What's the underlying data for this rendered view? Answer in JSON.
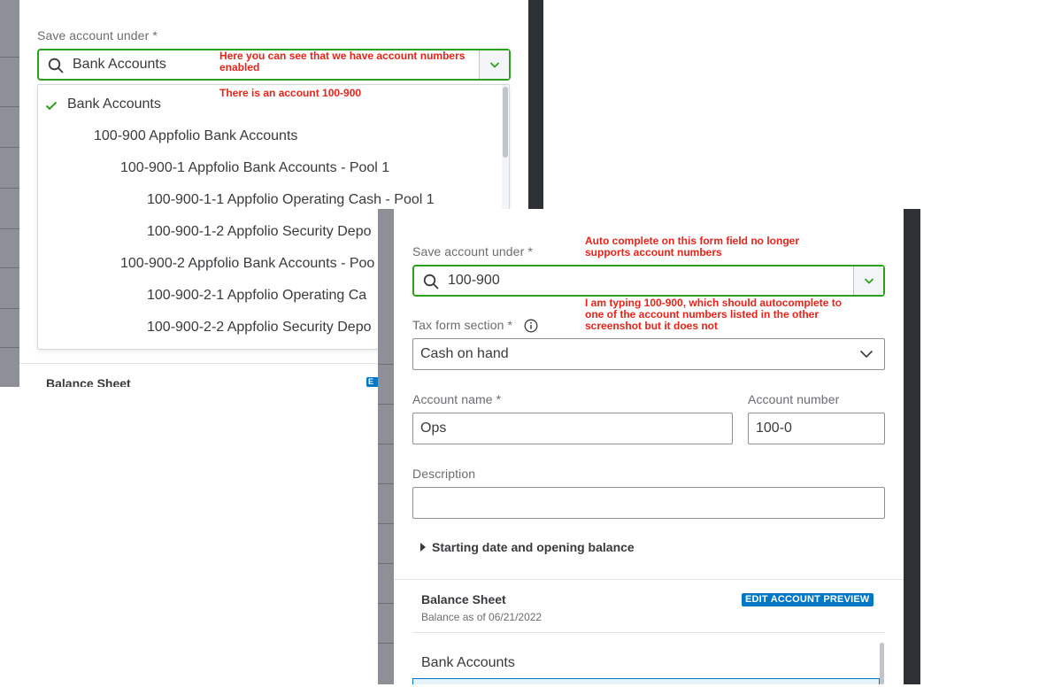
{
  "shotA": {
    "field_label": "Save account under *",
    "search_value": "Bank Accounts",
    "annotations": {
      "numbers_enabled": "Here you can see that we have account numbers enabled",
      "account_exists": "There is an account 100-900"
    },
    "dropdown_items": [
      {
        "label": "Bank Accounts",
        "selected": true
      },
      {
        "label": "100-900 Appfolio Bank Accounts",
        "selected": false
      },
      {
        "label": "100-900-1 Appfolio Bank Accounts - Pool 1",
        "selected": false
      },
      {
        "label": "100-900-1-1 Appfolio Operating Cash - Pool 1",
        "selected": false
      },
      {
        "label": "100-900-1-2 Appfolio Security Depo",
        "selected": false
      },
      {
        "label": "100-900-2 Appfolio Bank Accounts - Poo",
        "selected": false
      },
      {
        "label": "100-900-2-1 Appfolio Operating Ca",
        "selected": false
      },
      {
        "label": "100-900-2-2 Appfolio Security Depo",
        "selected": false
      }
    ],
    "balance_sheet_title": "Balance Sheet",
    "edit_preview_fragment": "E"
  },
  "shotB": {
    "save_under_label": "Save account under *",
    "save_under_value": "100-900",
    "annotations": {
      "autocomplete_issue": "Auto complete on this form field no longer supports account numbers",
      "typing_note": "I am typing 100-900, which should autocomplete to one of the account numbers listed in the other screenshot but it does not"
    },
    "tax_form_label": "Tax form section *",
    "tax_form_value": "Cash on hand",
    "account_name_label": "Account name *",
    "account_name_value": "Ops",
    "account_number_label": "Account number",
    "account_number_value": "100-0",
    "description_label": "Description",
    "description_value": "",
    "starting_toggle": "Starting date and opening balance",
    "balance_sheet_title": "Balance Sheet",
    "balance_date": "Balance as of 06/21/2022",
    "edit_preview_label": "EDIT ACCOUNT PREVIEW",
    "preview_item": "Bank Accounts"
  },
  "colors": {
    "focus_green": "#2ca01c",
    "annotation_red": "#e5241a",
    "link_blue": "#0077c5",
    "text_dark": "#393a3d",
    "side_dark": "#2d3136"
  },
  "icons": [
    "search-icon",
    "chevron-down-icon",
    "check-icon",
    "info-icon",
    "caret-right-icon"
  ]
}
